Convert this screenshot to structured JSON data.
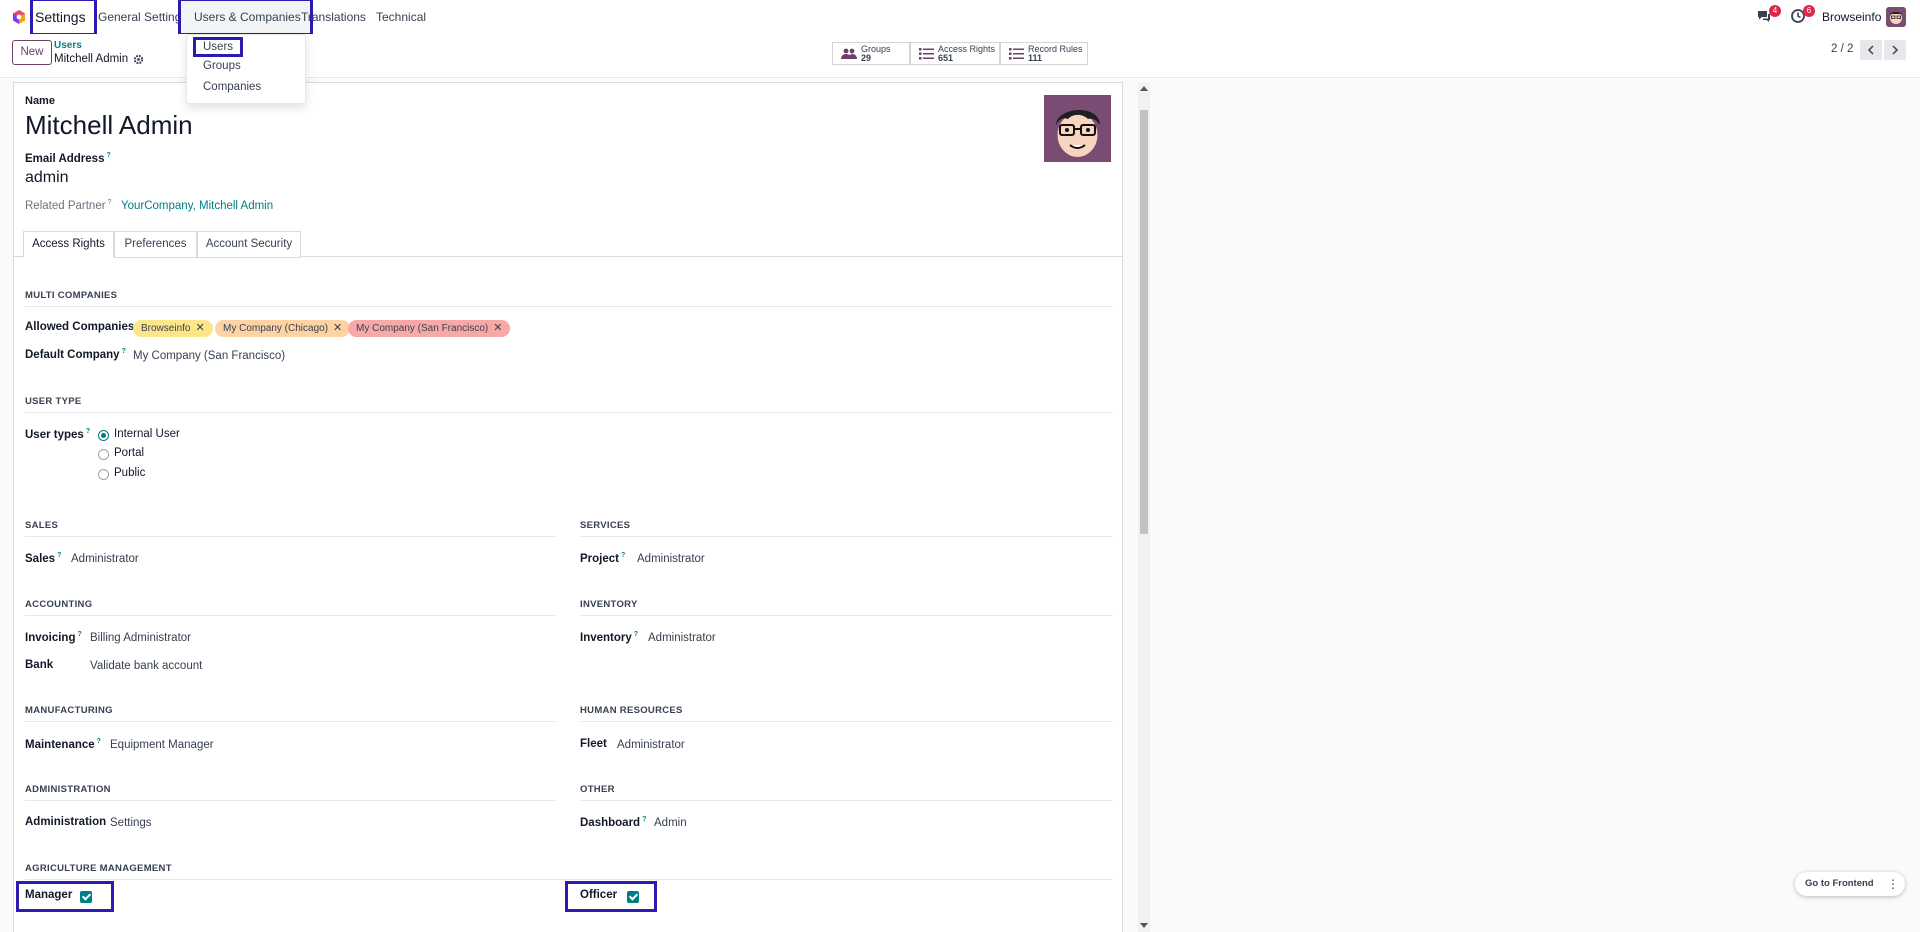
{
  "navbar": {
    "app_name": "Settings",
    "menus": [
      "General Settings",
      "Users & Companies",
      "Translations",
      "Technical"
    ],
    "messages_badge": "4",
    "activities_badge": "6",
    "company_name": "Browseinfo"
  },
  "dropdown": {
    "items": [
      "Users",
      "Groups",
      "Companies"
    ]
  },
  "control_panel": {
    "new_label": "New",
    "breadcrumb_parent": "Users",
    "breadcrumb_current": "Mitchell Admin",
    "smart_buttons": [
      {
        "label": "Groups",
        "value": "29"
      },
      {
        "label": "Access Rights",
        "value": "651"
      },
      {
        "label": "Record Rules",
        "value": "111"
      }
    ],
    "pager": "2 / 2"
  },
  "form": {
    "name_label": "Name",
    "name_value": "Mitchell Admin",
    "email_label": "Email Address",
    "email_value": "admin",
    "partner_label": "Related Partner",
    "partner_value": "YourCompany, Mitchell Admin",
    "help_mark": "?"
  },
  "tabs": [
    "Access Rights",
    "Preferences",
    "Account Security"
  ],
  "multi_companies": {
    "title": "MULTI COMPANIES",
    "allowed_label": "Allowed Companies",
    "tags": [
      {
        "label": "Browseinfo",
        "color": "#fde68a"
      },
      {
        "label": "My Company (Chicago)",
        "color": "#fdd3a4"
      },
      {
        "label": "My Company (San Francisco)",
        "color": "#f9a8a8"
      }
    ],
    "default_label": "Default Company",
    "default_value": "My Company (San Francisco)"
  },
  "user_type": {
    "title": "USER TYPE",
    "label": "User types",
    "options": [
      "Internal User",
      "Portal",
      "Public"
    ],
    "selected": "Internal User"
  },
  "sections": {
    "sales": {
      "title": "SALES",
      "label": "Sales",
      "value": "Administrator"
    },
    "services": {
      "title": "SERVICES",
      "label": "Project",
      "value": "Administrator"
    },
    "accounting": {
      "title": "ACCOUNTING",
      "invoicing_label": "Invoicing",
      "invoicing_value": "Billing Administrator",
      "bank_label": "Bank",
      "bank_value": "Validate bank account"
    },
    "inventory": {
      "title": "INVENTORY",
      "label": "Inventory",
      "value": "Administrator"
    },
    "manufacturing": {
      "title": "MANUFACTURING",
      "label": "Maintenance",
      "value": "Equipment Manager"
    },
    "human_resources": {
      "title": "HUMAN RESOURCES",
      "label": "Fleet",
      "value": "Administrator"
    },
    "administration": {
      "title": "ADMINISTRATION",
      "label": "Administration",
      "value": "Settings"
    },
    "other": {
      "title": "OTHER",
      "label": "Dashboard",
      "value": "Admin"
    },
    "agriculture": {
      "title": "AGRICULTURE MANAGEMENT",
      "manager_label": "Manager",
      "officer_label": "Officer"
    }
  },
  "footer": {
    "goto_frontend": "Go to Frontend",
    "more": "⋮"
  },
  "colors": {
    "accent": "#017e84",
    "brand": "#71406a",
    "highlight": "#2b1bb0"
  }
}
